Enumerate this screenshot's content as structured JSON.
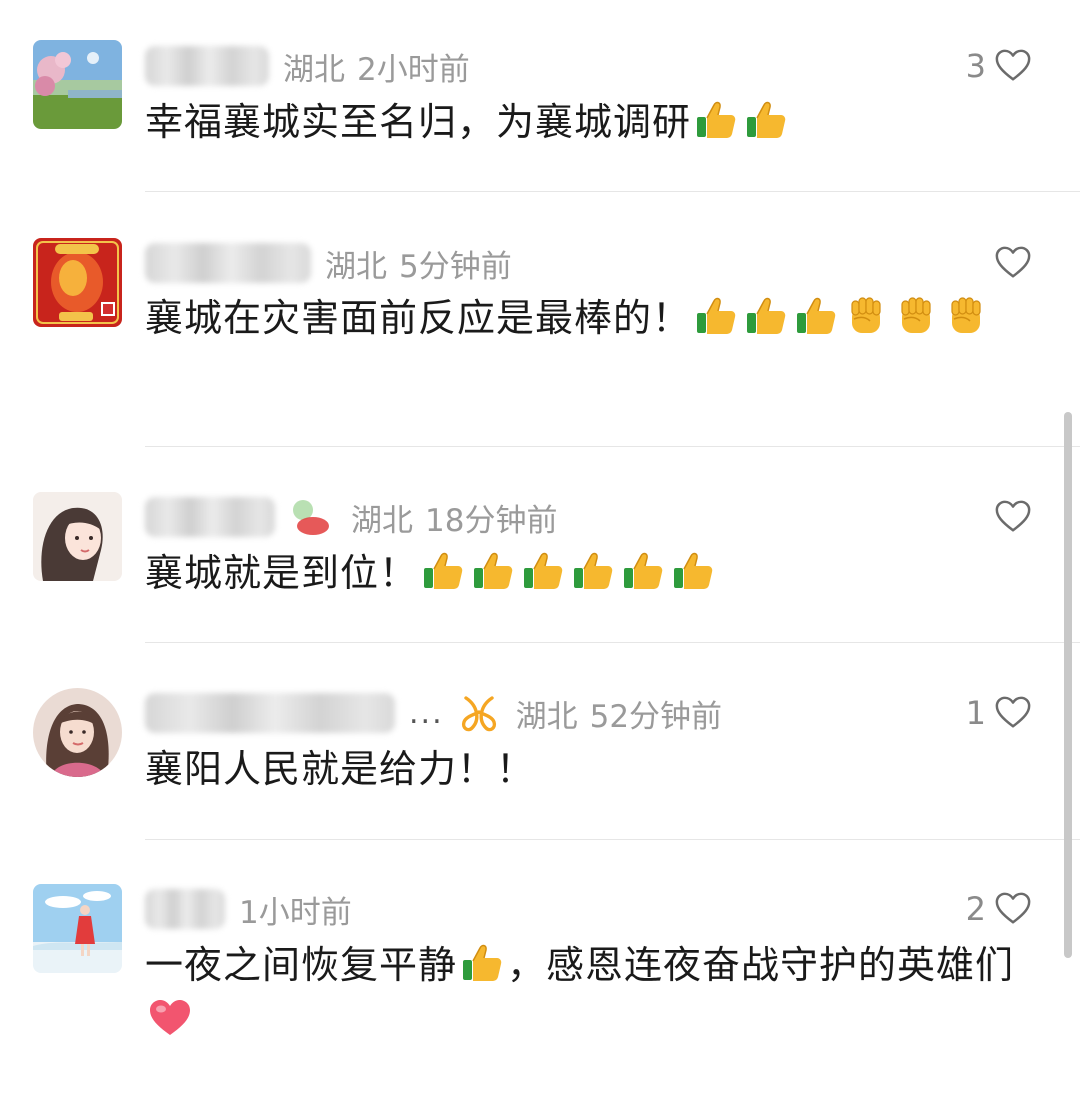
{
  "comments": [
    {
      "location": "湖北",
      "time": "2小时前",
      "likes": "3",
      "text_parts": [
        "幸福襄城实至名归，为襄城调研",
        "",
        "",
        ""
      ],
      "emojis": [
        "thumbs-up",
        "thumbs-up"
      ]
    },
    {
      "location": "湖北",
      "time": "5分钟前",
      "likes": "",
      "text_parts": [
        "襄城在灾害面前反应是最棒的！"
      ],
      "emojis": [
        "thumbs-up",
        "thumbs-up",
        "thumbs-up",
        "raised-fist",
        "raised-fist",
        "raised-fist"
      ]
    },
    {
      "location": "湖北",
      "time": "18分钟前",
      "likes": "",
      "text_parts": [
        "襄城就是到位！"
      ],
      "emojis": [
        "thumbs-up",
        "thumbs-up",
        "thumbs-up",
        "thumbs-up",
        "thumbs-up",
        "thumbs-up"
      ]
    },
    {
      "name_suffix": "...",
      "badge": "orange-ribbon-icon",
      "location": "湖北",
      "time": "52分钟前",
      "likes": "1",
      "text_parts": [
        "襄阳人民就是给力！！"
      ],
      "emojis": []
    },
    {
      "location": "",
      "time": "1小时前",
      "likes": "2",
      "text_parts": [
        "一夜之间恢复平静",
        "，感恩连夜奋战守护的英雄们"
      ],
      "emojis": [
        "thumbs-up",
        "red-heart"
      ]
    }
  ],
  "colors": {
    "meta_gray": "#9a9a9a",
    "text": "#1a1a1a",
    "divider": "#e6e6e6",
    "badge_orange": "#f5a623"
  }
}
